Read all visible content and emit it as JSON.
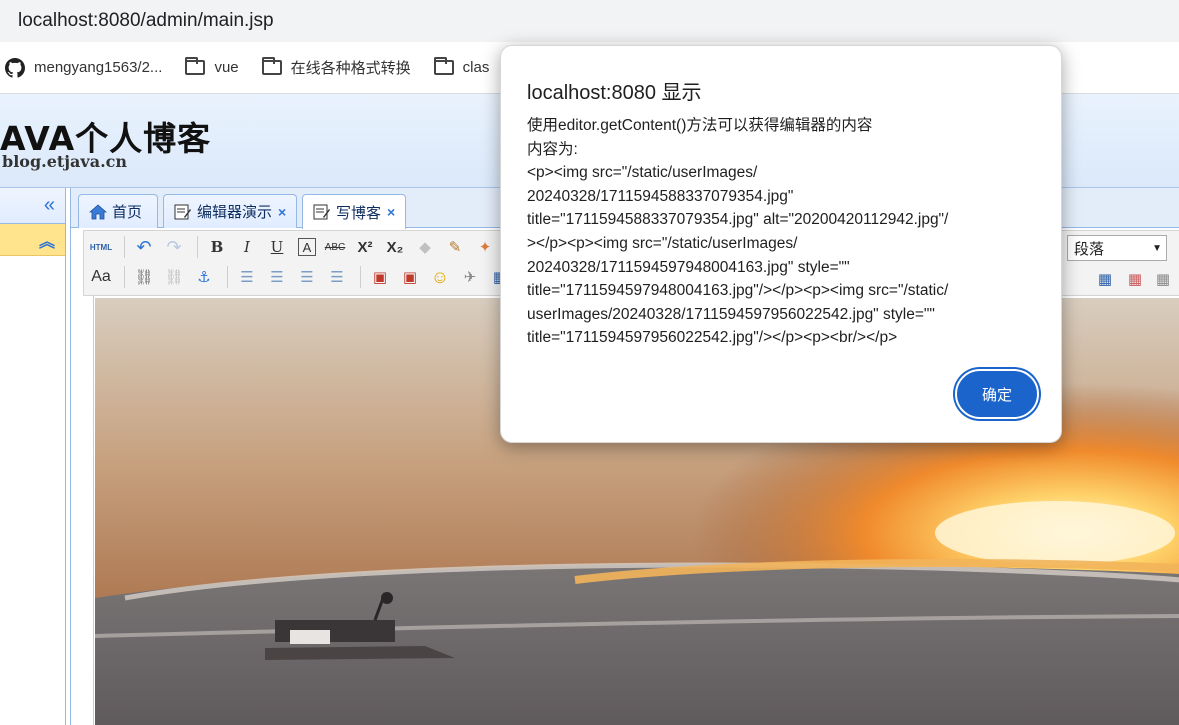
{
  "browser": {
    "url": "localhost:8080/admin/main.jsp",
    "bookmarks": [
      {
        "label": "mengyang1563/2...",
        "icon": "github-icon"
      },
      {
        "label": "vue",
        "icon": "folder-icon"
      },
      {
        "label": "在线各种格式转换",
        "icon": "folder-icon"
      },
      {
        "label": "clas",
        "icon": "folder-icon"
      }
    ]
  },
  "blog": {
    "logo_main": "AVA个人博客",
    "logo_sub": "blog.etjava.cn"
  },
  "sidebar": {
    "collapse_icon": "«",
    "section_icon": "︽"
  },
  "tabs": [
    {
      "label": "首页",
      "icon": "home-icon"
    },
    {
      "label": "编辑器演示",
      "icon": "edit-icon",
      "close": "×"
    },
    {
      "label": "写博客",
      "icon": "edit-icon",
      "close": "×"
    }
  ],
  "toolbar": {
    "html_label": "HTML",
    "paragraph_select": "段落"
  },
  "dialog": {
    "title": "localhost:8080 显示",
    "message_lines": [
      "使用editor.getContent()方法可以获得编辑器的内容",
      "内容为:",
      "<p><img src=\"/static/userImages/",
      "20240328/1711594588337079354.jpg\"",
      "title=\"1711594588337079354.jpg\" alt=\"20200420112942.jpg\"/",
      "></p><p><img src=\"/static/userImages/",
      "20240328/1711594597948004163.jpg\" style=\"\"",
      "title=\"1711594597948004163.jpg\"/></p><p><img src=\"/static/",
      "userImages/20240328/1711594597956022542.jpg\" style=\"\"",
      "title=\"1711594597956022542.jpg\"/></p><p><br/></p>"
    ],
    "ok_label": "确定"
  }
}
